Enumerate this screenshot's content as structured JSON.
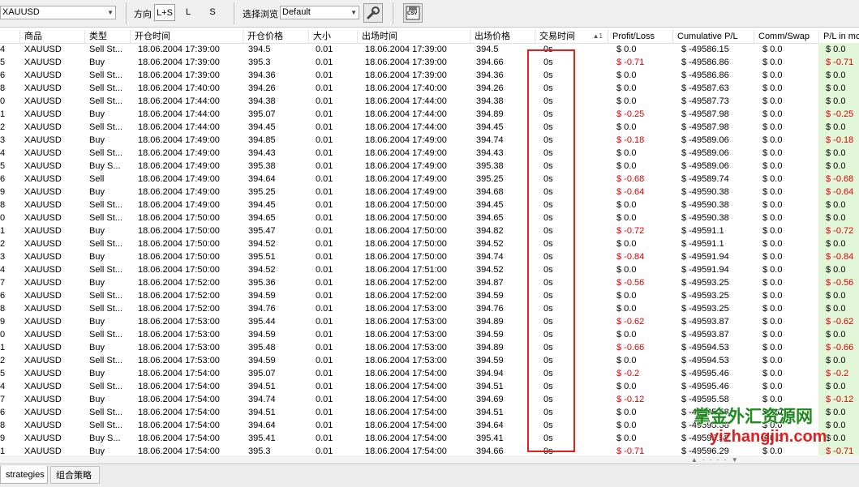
{
  "toolbar": {
    "symbol_value": "XAUUSD",
    "direction_label": "方向",
    "dir_buttons": [
      "L+S",
      "L",
      "S"
    ],
    "view_label": "选择浏览",
    "view_value": "Default",
    "csv_label": "CSV"
  },
  "columns": [
    "",
    "商品",
    "类型",
    "开仓时间",
    "开仓价格",
    "大小",
    "出场时间",
    "出场价格",
    "交易时间",
    "Profit/Loss",
    "Cumulative P/L",
    "Comm/Swap",
    "P/L in mo"
  ],
  "sort_indicator": "▲1",
  "rows": [
    [
      "4",
      "XAUUSD",
      "Sell St...",
      "18.06.2004 17:39:00",
      "394.5",
      "0.01",
      "18.06.2004 17:39:00",
      "394.5",
      "0s",
      "$ 0.0",
      "$ -49586.15",
      "$ 0.0",
      "$ 0.0"
    ],
    [
      "5",
      "XAUUSD",
      "Buy",
      "18.06.2004 17:39:00",
      "395.3",
      "0.01",
      "18.06.2004 17:39:00",
      "394.66",
      "0s",
      "$ -0.71",
      "$ -49586.86",
      "$ 0.0",
      "$ -0.71"
    ],
    [
      "6",
      "XAUUSD",
      "Sell St...",
      "18.06.2004 17:39:00",
      "394.36",
      "0.01",
      "18.06.2004 17:39:00",
      "394.36",
      "0s",
      "$ 0.0",
      "$ -49586.86",
      "$ 0.0",
      "$ 0.0"
    ],
    [
      "8",
      "XAUUSD",
      "Sell St...",
      "18.06.2004 17:40:00",
      "394.26",
      "0.01",
      "18.06.2004 17:40:00",
      "394.26",
      "0s",
      "$ 0.0",
      "$ -49587.63",
      "$ 0.0",
      "$ 0.0"
    ],
    [
      "0",
      "XAUUSD",
      "Sell St...",
      "18.06.2004 17:44:00",
      "394.38",
      "0.01",
      "18.06.2004 17:44:00",
      "394.38",
      "0s",
      "$ 0.0",
      "$ -49587.73",
      "$ 0.0",
      "$ 0.0"
    ],
    [
      "1",
      "XAUUSD",
      "Buy",
      "18.06.2004 17:44:00",
      "395.07",
      "0.01",
      "18.06.2004 17:44:00",
      "394.89",
      "0s",
      "$ -0.25",
      "$ -49587.98",
      "$ 0.0",
      "$ -0.25"
    ],
    [
      "2",
      "XAUUSD",
      "Sell St...",
      "18.06.2004 17:44:00",
      "394.45",
      "0.01",
      "18.06.2004 17:44:00",
      "394.45",
      "0s",
      "$ 0.0",
      "$ -49587.98",
      "$ 0.0",
      "$ 0.0"
    ],
    [
      "3",
      "XAUUSD",
      "Buy",
      "18.06.2004 17:49:00",
      "394.85",
      "0.01",
      "18.06.2004 17:49:00",
      "394.74",
      "0s",
      "$ -0.18",
      "$ -49589.06",
      "$ 0.0",
      "$ -0.18"
    ],
    [
      "4",
      "XAUUSD",
      "Sell St...",
      "18.06.2004 17:49:00",
      "394.43",
      "0.01",
      "18.06.2004 17:49:00",
      "394.43",
      "0s",
      "$ 0.0",
      "$ -49589.06",
      "$ 0.0",
      "$ 0.0"
    ],
    [
      "5",
      "XAUUSD",
      "Buy S...",
      "18.06.2004 17:49:00",
      "395.38",
      "0.01",
      "18.06.2004 17:49:00",
      "395.38",
      "0s",
      "$ 0.0",
      "$ -49589.06",
      "$ 0.0",
      "$ 0.0"
    ],
    [
      "6",
      "XAUUSD",
      "Sell",
      "18.06.2004 17:49:00",
      "394.64",
      "0.01",
      "18.06.2004 17:49:00",
      "395.25",
      "0s",
      "$ -0.68",
      "$ -49589.74",
      "$ 0.0",
      "$ -0.68"
    ],
    [
      "9",
      "XAUUSD",
      "Buy",
      "18.06.2004 17:49:00",
      "395.25",
      "0.01",
      "18.06.2004 17:49:00",
      "394.68",
      "0s",
      "$ -0.64",
      "$ -49590.38",
      "$ 0.0",
      "$ -0.64"
    ],
    [
      "8",
      "XAUUSD",
      "Sell St...",
      "18.06.2004 17:49:00",
      "394.45",
      "0.01",
      "18.06.2004 17:50:00",
      "394.45",
      "0s",
      "$ 0.0",
      "$ -49590.38",
      "$ 0.0",
      "$ 0.0"
    ],
    [
      "0",
      "XAUUSD",
      "Sell St...",
      "18.06.2004 17:50:00",
      "394.65",
      "0.01",
      "18.06.2004 17:50:00",
      "394.65",
      "0s",
      "$ 0.0",
      "$ -49590.38",
      "$ 0.0",
      "$ 0.0"
    ],
    [
      "1",
      "XAUUSD",
      "Buy",
      "18.06.2004 17:50:00",
      "395.47",
      "0.01",
      "18.06.2004 17:50:00",
      "394.82",
      "0s",
      "$ -0.72",
      "$ -49591.1",
      "$ 0.0",
      "$ -0.72"
    ],
    [
      "2",
      "XAUUSD",
      "Sell St...",
      "18.06.2004 17:50:00",
      "394.52",
      "0.01",
      "18.06.2004 17:50:00",
      "394.52",
      "0s",
      "$ 0.0",
      "$ -49591.1",
      "$ 0.0",
      "$ 0.0"
    ],
    [
      "3",
      "XAUUSD",
      "Buy",
      "18.06.2004 17:50:00",
      "395.51",
      "0.01",
      "18.06.2004 17:50:00",
      "394.74",
      "0s",
      "$ -0.84",
      "$ -49591.94",
      "$ 0.0",
      "$ -0.84"
    ],
    [
      "4",
      "XAUUSD",
      "Sell St...",
      "18.06.2004 17:50:00",
      "394.52",
      "0.01",
      "18.06.2004 17:51:00",
      "394.52",
      "0s",
      "$ 0.0",
      "$ -49591.94",
      "$ 0.0",
      "$ 0.0"
    ],
    [
      "7",
      "XAUUSD",
      "Buy",
      "18.06.2004 17:52:00",
      "395.36",
      "0.01",
      "18.06.2004 17:52:00",
      "394.87",
      "0s",
      "$ -0.56",
      "$ -49593.25",
      "$ 0.0",
      "$ -0.56"
    ],
    [
      "6",
      "XAUUSD",
      "Sell St...",
      "18.06.2004 17:52:00",
      "394.59",
      "0.01",
      "18.06.2004 17:52:00",
      "394.59",
      "0s",
      "$ 0.0",
      "$ -49593.25",
      "$ 0.0",
      "$ 0.0"
    ],
    [
      "8",
      "XAUUSD",
      "Sell St...",
      "18.06.2004 17:52:00",
      "394.76",
      "0.01",
      "18.06.2004 17:53:00",
      "394.76",
      "0s",
      "$ 0.0",
      "$ -49593.25",
      "$ 0.0",
      "$ 0.0"
    ],
    [
      "9",
      "XAUUSD",
      "Buy",
      "18.06.2004 17:53:00",
      "395.44",
      "0.01",
      "18.06.2004 17:53:00",
      "394.89",
      "0s",
      "$ -0.62",
      "$ -49593.87",
      "$ 0.0",
      "$ -0.62"
    ],
    [
      "0",
      "XAUUSD",
      "Sell St...",
      "18.06.2004 17:53:00",
      "394.59",
      "0.01",
      "18.06.2004 17:53:00",
      "394.59",
      "0s",
      "$ 0.0",
      "$ -49593.87",
      "$ 0.0",
      "$ 0.0"
    ],
    [
      "1",
      "XAUUSD",
      "Buy",
      "18.06.2004 17:53:00",
      "395.48",
      "0.01",
      "18.06.2004 17:53:00",
      "394.89",
      "0s",
      "$ -0.66",
      "$ -49594.53",
      "$ 0.0",
      "$ -0.66"
    ],
    [
      "2",
      "XAUUSD",
      "Sell St...",
      "18.06.2004 17:53:00",
      "394.59",
      "0.01",
      "18.06.2004 17:53:00",
      "394.59",
      "0s",
      "$ 0.0",
      "$ -49594.53",
      "$ 0.0",
      "$ 0.0"
    ],
    [
      "5",
      "XAUUSD",
      "Buy",
      "18.06.2004 17:54:00",
      "395.07",
      "0.01",
      "18.06.2004 17:54:00",
      "394.94",
      "0s",
      "$ -0.2",
      "$ -49595.46",
      "$ 0.0",
      "$ -0.2"
    ],
    [
      "4",
      "XAUUSD",
      "Sell St...",
      "18.06.2004 17:54:00",
      "394.51",
      "0.01",
      "18.06.2004 17:54:00",
      "394.51",
      "0s",
      "$ 0.0",
      "$ -49595.46",
      "$ 0.0",
      "$ 0.0"
    ],
    [
      "7",
      "XAUUSD",
      "Buy",
      "18.06.2004 17:54:00",
      "394.74",
      "0.01",
      "18.06.2004 17:54:00",
      "394.69",
      "0s",
      "$ -0.12",
      "$ -49595.58",
      "$ 0.0",
      "$ -0.12"
    ],
    [
      "6",
      "XAUUSD",
      "Sell St...",
      "18.06.2004 17:54:00",
      "394.51",
      "0.01",
      "18.06.2004 17:54:00",
      "394.51",
      "0s",
      "$ 0.0",
      "$ -49595.58",
      "$ 0.0",
      "$ 0.0"
    ],
    [
      "8",
      "XAUUSD",
      "Sell St...",
      "18.06.2004 17:54:00",
      "394.64",
      "0.01",
      "18.06.2004 17:54:00",
      "394.64",
      "0s",
      "$ 0.0",
      "$ -49595.58",
      "$ 0.0",
      "$ 0.0"
    ],
    [
      "9",
      "XAUUSD",
      "Buy S...",
      "18.06.2004 17:54:00",
      "395.41",
      "0.01",
      "18.06.2004 17:54:00",
      "395.41",
      "0s",
      "$ 0.0",
      "$ -49595.58",
      "$ 0.0",
      "$ 0.0"
    ],
    [
      "1",
      "XAUUSD",
      "Buy",
      "18.06.2004 17:54:00",
      "395.3",
      "0.01",
      "18.06.2004 17:54:00",
      "394.66",
      "0s",
      "$ -0.71",
      "$ -49596.29",
      "$ 0.0",
      "$ -0.71"
    ]
  ],
  "bottom_tabs": [
    "strategies",
    "组合策略"
  ],
  "watermark": {
    "line1": "掌金外汇资源网",
    "line2": "yizhangjin.com"
  },
  "scroll_indicator": "▲ - - - - ▼",
  "colors": {
    "negative": "#e00000",
    "pl_bg": "#e2f7d8",
    "highlight": "#e32020"
  }
}
